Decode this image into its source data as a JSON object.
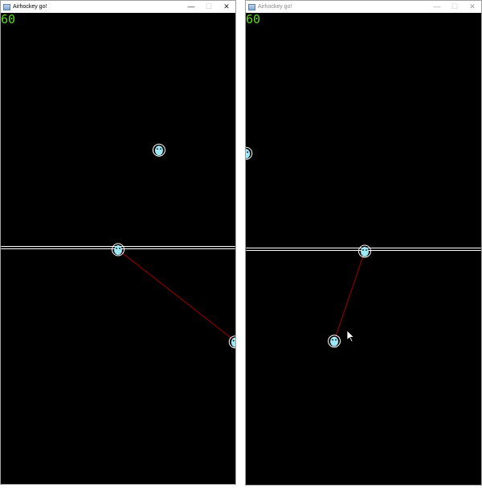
{
  "windows": [
    {
      "title": "Airhockey go!",
      "state": "active",
      "controls": {
        "minimize": "—",
        "maximize": "☐",
        "close": "✕"
      },
      "hud": {
        "fps": "60"
      }
    },
    {
      "title": "Airhockey go!",
      "state": "inactive",
      "controls": {
        "minimize": "—",
        "maximize": "☐",
        "close": "✕"
      },
      "hud": {
        "fps": "60"
      }
    }
  ],
  "colors": {
    "background": "#000000",
    "fps_text": "#5fd818",
    "paddle_fill": "#9ee8f5",
    "paddle_ring": "#ffffff",
    "aim_line": "#8b0000",
    "center_line": "#ffffff"
  },
  "icons": [
    "app-window-icon",
    "minimize-icon",
    "maximize-icon",
    "close-icon",
    "mouse-pointer-icon"
  ]
}
